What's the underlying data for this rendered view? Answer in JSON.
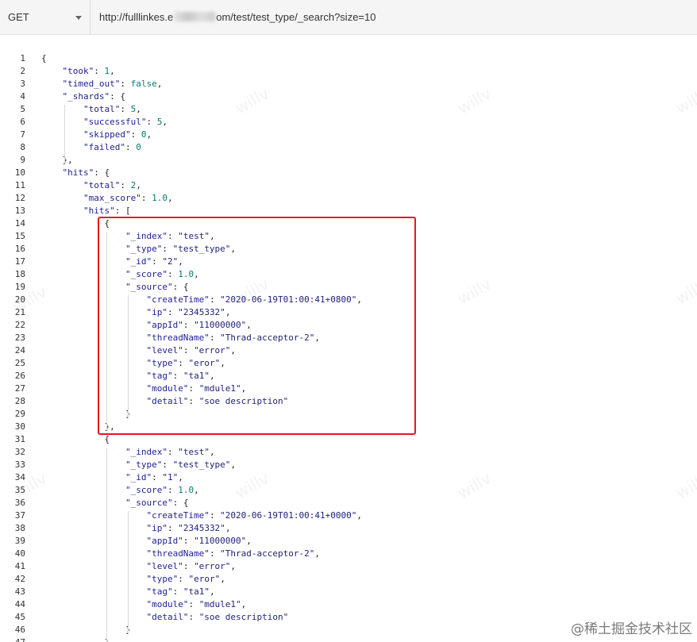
{
  "request": {
    "method": "GET",
    "url_start": "http://fulllinkes.e",
    "url_end": "om/test/test_type/_search?size=10"
  },
  "watermark": "willv",
  "credit": "@稀土掘金技术社区",
  "lines": [
    {
      "n": "1",
      "indent": 0,
      "t": [
        [
          "p",
          "{"
        ]
      ]
    },
    {
      "n": "2",
      "indent": 1,
      "t": [
        [
          "k",
          "\"took\""
        ],
        [
          "p",
          ": "
        ],
        [
          "n",
          "1"
        ],
        [
          "p",
          ","
        ]
      ]
    },
    {
      "n": "3",
      "indent": 1,
      "t": [
        [
          "k",
          "\"timed_out\""
        ],
        [
          "p",
          ": "
        ],
        [
          "b",
          "false"
        ],
        [
          "p",
          ","
        ]
      ]
    },
    {
      "n": "4",
      "indent": 1,
      "t": [
        [
          "k",
          "\"_shards\""
        ],
        [
          "p",
          ": {"
        ]
      ]
    },
    {
      "n": "5",
      "indent": 2,
      "t": [
        [
          "k",
          "\"total\""
        ],
        [
          "p",
          ": "
        ],
        [
          "n",
          "5"
        ],
        [
          "p",
          ","
        ]
      ]
    },
    {
      "n": "6",
      "indent": 2,
      "t": [
        [
          "k",
          "\"successful\""
        ],
        [
          "p",
          ": "
        ],
        [
          "n",
          "5"
        ],
        [
          "p",
          ","
        ]
      ]
    },
    {
      "n": "7",
      "indent": 2,
      "t": [
        [
          "k",
          "\"skipped\""
        ],
        [
          "p",
          ": "
        ],
        [
          "n",
          "0"
        ],
        [
          "p",
          ","
        ]
      ]
    },
    {
      "n": "8",
      "indent": 2,
      "t": [
        [
          "k",
          "\"failed\""
        ],
        [
          "p",
          ": "
        ],
        [
          "n",
          "0"
        ]
      ]
    },
    {
      "n": "9",
      "indent": 1,
      "t": [
        [
          "p",
          "},"
        ]
      ]
    },
    {
      "n": "10",
      "indent": 1,
      "t": [
        [
          "k",
          "\"hits\""
        ],
        [
          "p",
          ": {"
        ]
      ]
    },
    {
      "n": "11",
      "indent": 2,
      "t": [
        [
          "k",
          "\"total\""
        ],
        [
          "p",
          ": "
        ],
        [
          "n",
          "2"
        ],
        [
          "p",
          ","
        ]
      ]
    },
    {
      "n": "12",
      "indent": 2,
      "t": [
        [
          "k",
          "\"max_score\""
        ],
        [
          "p",
          ": "
        ],
        [
          "n",
          "1.0"
        ],
        [
          "p",
          ","
        ]
      ]
    },
    {
      "n": "13",
      "indent": 2,
      "t": [
        [
          "k",
          "\"hits\""
        ],
        [
          "p",
          ": ["
        ]
      ]
    },
    {
      "n": "14",
      "indent": 3,
      "t": [
        [
          "p",
          "{"
        ]
      ]
    },
    {
      "n": "15",
      "indent": 4,
      "t": [
        [
          "k",
          "\"_index\""
        ],
        [
          "p",
          ": "
        ],
        [
          "s",
          "\"test\""
        ],
        [
          "p",
          ","
        ]
      ]
    },
    {
      "n": "16",
      "indent": 4,
      "t": [
        [
          "k",
          "\"_type\""
        ],
        [
          "p",
          ": "
        ],
        [
          "s",
          "\"test_type\""
        ],
        [
          "p",
          ","
        ]
      ]
    },
    {
      "n": "17",
      "indent": 4,
      "t": [
        [
          "k",
          "\"_id\""
        ],
        [
          "p",
          ": "
        ],
        [
          "s",
          "\"2\""
        ],
        [
          "p",
          ","
        ]
      ]
    },
    {
      "n": "18",
      "indent": 4,
      "t": [
        [
          "k",
          "\"_score\""
        ],
        [
          "p",
          ": "
        ],
        [
          "n",
          "1.0"
        ],
        [
          "p",
          ","
        ]
      ]
    },
    {
      "n": "19",
      "indent": 4,
      "t": [
        [
          "k",
          "\"_source\""
        ],
        [
          "p",
          ": {"
        ]
      ]
    },
    {
      "n": "20",
      "indent": 5,
      "t": [
        [
          "k",
          "\"createTime\""
        ],
        [
          "p",
          ": "
        ],
        [
          "s",
          "\"2020-06-19T01:00:41+0800\""
        ],
        [
          "p",
          ","
        ]
      ]
    },
    {
      "n": "21",
      "indent": 5,
      "t": [
        [
          "k",
          "\"ip\""
        ],
        [
          "p",
          ": "
        ],
        [
          "s",
          "\"2345332\""
        ],
        [
          "p",
          ","
        ]
      ]
    },
    {
      "n": "22",
      "indent": 5,
      "t": [
        [
          "k",
          "\"appId\""
        ],
        [
          "p",
          ": "
        ],
        [
          "s",
          "\"11000000\""
        ],
        [
          "p",
          ","
        ]
      ]
    },
    {
      "n": "23",
      "indent": 5,
      "t": [
        [
          "k",
          "\"threadName\""
        ],
        [
          "p",
          ": "
        ],
        [
          "s",
          "\"Thrad-acceptor-2\""
        ],
        [
          "p",
          ","
        ]
      ]
    },
    {
      "n": "24",
      "indent": 5,
      "t": [
        [
          "k",
          "\"level\""
        ],
        [
          "p",
          ": "
        ],
        [
          "s",
          "\"error\""
        ],
        [
          "p",
          ","
        ]
      ]
    },
    {
      "n": "25",
      "indent": 5,
      "t": [
        [
          "k",
          "\"type\""
        ],
        [
          "p",
          ": "
        ],
        [
          "s",
          "\"eror\""
        ],
        [
          "p",
          ","
        ]
      ]
    },
    {
      "n": "26",
      "indent": 5,
      "t": [
        [
          "k",
          "\"tag\""
        ],
        [
          "p",
          ": "
        ],
        [
          "s",
          "\"ta1\""
        ],
        [
          "p",
          ","
        ]
      ]
    },
    {
      "n": "27",
      "indent": 5,
      "t": [
        [
          "k",
          "\"module\""
        ],
        [
          "p",
          ": "
        ],
        [
          "s",
          "\"mdule1\""
        ],
        [
          "p",
          ","
        ]
      ]
    },
    {
      "n": "28",
      "indent": 5,
      "t": [
        [
          "k",
          "\"detail\""
        ],
        [
          "p",
          ": "
        ],
        [
          "s",
          "\"soe description\""
        ]
      ]
    },
    {
      "n": "29",
      "indent": 4,
      "t": [
        [
          "p",
          "}"
        ]
      ]
    },
    {
      "n": "30",
      "indent": 3,
      "t": [
        [
          "p",
          "},"
        ]
      ]
    },
    {
      "n": "31",
      "indent": 3,
      "t": [
        [
          "p",
          "{"
        ]
      ]
    },
    {
      "n": "32",
      "indent": 4,
      "t": [
        [
          "k",
          "\"_index\""
        ],
        [
          "p",
          ": "
        ],
        [
          "s",
          "\"test\""
        ],
        [
          "p",
          ","
        ]
      ]
    },
    {
      "n": "33",
      "indent": 4,
      "t": [
        [
          "k",
          "\"_type\""
        ],
        [
          "p",
          ": "
        ],
        [
          "s",
          "\"test_type\""
        ],
        [
          "p",
          ","
        ]
      ]
    },
    {
      "n": "34",
      "indent": 4,
      "t": [
        [
          "k",
          "\"_id\""
        ],
        [
          "p",
          ": "
        ],
        [
          "s",
          "\"1\""
        ],
        [
          "p",
          ","
        ]
      ]
    },
    {
      "n": "35",
      "indent": 4,
      "t": [
        [
          "k",
          "\"_score\""
        ],
        [
          "p",
          ": "
        ],
        [
          "n",
          "1.0"
        ],
        [
          "p",
          ","
        ]
      ]
    },
    {
      "n": "36",
      "indent": 4,
      "t": [
        [
          "k",
          "\"_source\""
        ],
        [
          "p",
          ": {"
        ]
      ]
    },
    {
      "n": "37",
      "indent": 5,
      "t": [
        [
          "k",
          "\"createTime\""
        ],
        [
          "p",
          ": "
        ],
        [
          "s",
          "\"2020-06-19T01:00:41+0000\""
        ],
        [
          "p",
          ","
        ]
      ]
    },
    {
      "n": "38",
      "indent": 5,
      "t": [
        [
          "k",
          "\"ip\""
        ],
        [
          "p",
          ": "
        ],
        [
          "s",
          "\"2345332\""
        ],
        [
          "p",
          ","
        ]
      ]
    },
    {
      "n": "39",
      "indent": 5,
      "t": [
        [
          "k",
          "\"appId\""
        ],
        [
          "p",
          ": "
        ],
        [
          "s",
          "\"11000000\""
        ],
        [
          "p",
          ","
        ]
      ]
    },
    {
      "n": "40",
      "indent": 5,
      "t": [
        [
          "k",
          "\"threadName\""
        ],
        [
          "p",
          ": "
        ],
        [
          "s",
          "\"Thrad-acceptor-2\""
        ],
        [
          "p",
          ","
        ]
      ]
    },
    {
      "n": "41",
      "indent": 5,
      "t": [
        [
          "k",
          "\"level\""
        ],
        [
          "p",
          ": "
        ],
        [
          "s",
          "\"error\""
        ],
        [
          "p",
          ","
        ]
      ]
    },
    {
      "n": "42",
      "indent": 5,
      "t": [
        [
          "k",
          "\"type\""
        ],
        [
          "p",
          ": "
        ],
        [
          "s",
          "\"eror\""
        ],
        [
          "p",
          ","
        ]
      ]
    },
    {
      "n": "43",
      "indent": 5,
      "t": [
        [
          "k",
          "\"tag\""
        ],
        [
          "p",
          ": "
        ],
        [
          "s",
          "\"ta1\""
        ],
        [
          "p",
          ","
        ]
      ]
    },
    {
      "n": "44",
      "indent": 5,
      "t": [
        [
          "k",
          "\"module\""
        ],
        [
          "p",
          ": "
        ],
        [
          "s",
          "\"mdule1\""
        ],
        [
          "p",
          ","
        ]
      ]
    },
    {
      "n": "45",
      "indent": 5,
      "t": [
        [
          "k",
          "\"detail\""
        ],
        [
          "p",
          ": "
        ],
        [
          "s",
          "\"soe description\""
        ]
      ]
    },
    {
      "n": "46",
      "indent": 4,
      "t": [
        [
          "p",
          "}"
        ]
      ]
    },
    {
      "n": "47",
      "indent": 3,
      "t": [
        [
          "p",
          "}"
        ]
      ]
    }
  ]
}
